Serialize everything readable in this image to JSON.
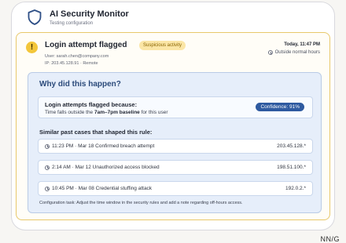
{
  "app": {
    "title": "AI Security Monitor",
    "subtitle": "Testing configuration"
  },
  "alert": {
    "title": "Login attempt flagged",
    "badge": "Suspicious activity",
    "user": "User: sarah.chen@company.com",
    "ip": "IP: 203.45.128.91 · Remote",
    "time": "Today, 11:47 PM",
    "time_note": "Outside normal hours"
  },
  "why": {
    "title": "Why did this happen?",
    "flag_heading": "Login attempts flagged because:",
    "flag_text_prefix": "Time falls outside the ",
    "flag_text_bold": "7am–7pm baseline",
    "flag_text_suffix": " for this user",
    "confidence": "Confidence: 91%",
    "similar_heading": "Similar past cases that shaped this rule:",
    "cases": [
      {
        "time": "11:23 PM · Mar 18 Confirmed breach attempt",
        "ip": "203.45.128.*"
      },
      {
        "time": "2:14 AM · Mar 12 Unauthorized access blocked",
        "ip": "198.51.100.*"
      },
      {
        "time": "10:45 PM · Mar 08 Credential stuffing attack",
        "ip": "192.0.2.*"
      }
    ],
    "task": "Configuration task: Adjust the time window in the security rules and add a note regarding off-hours access."
  },
  "corner": "NN/G",
  "colors": {
    "warning": "#f3c63b",
    "panel": "#e6eefa",
    "confidence": "#2e5aa0"
  }
}
